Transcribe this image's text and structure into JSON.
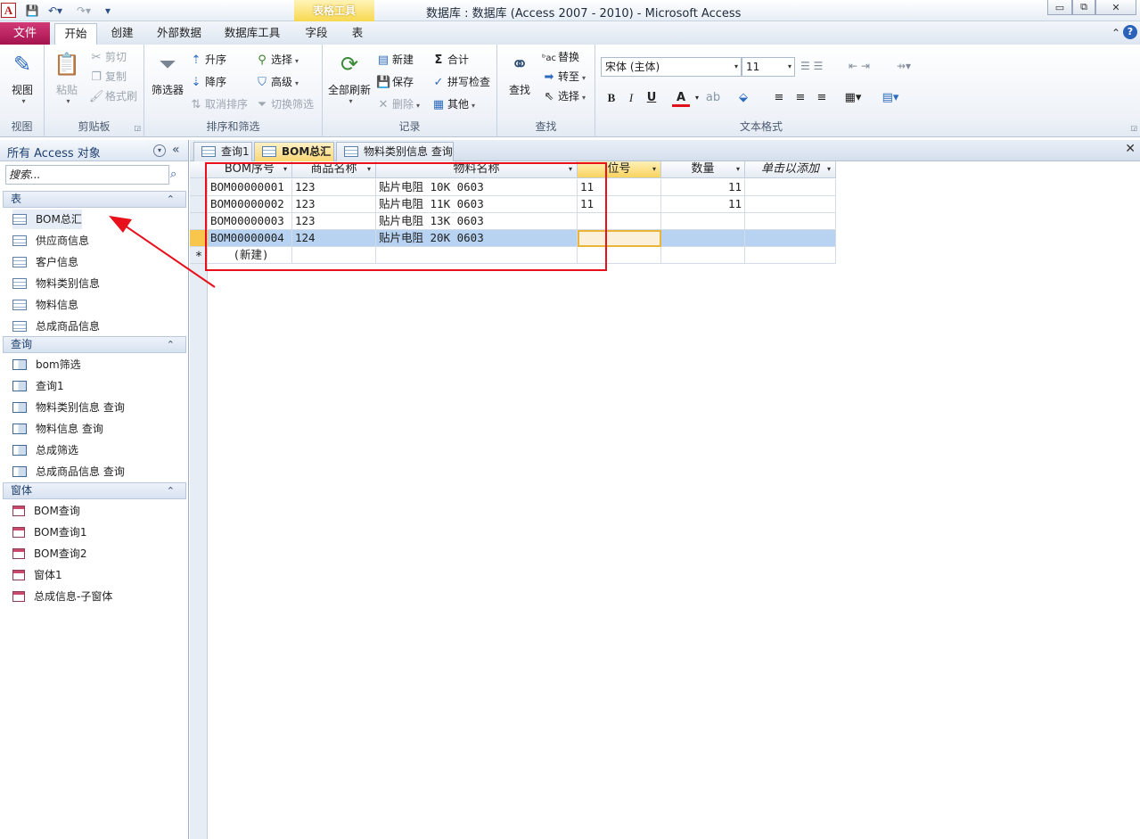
{
  "titlebar": {
    "app_icon": "A",
    "context_tab": "表格工具",
    "title": "数据库 : 数据库 (Access 2007 - 2010)  -  Microsoft Access",
    "minimize": "▭",
    "restore": "⧉",
    "close": "✕"
  },
  "ribbon_tabs": {
    "file": "文件",
    "tabs": [
      "开始",
      "创建",
      "外部数据",
      "数据库工具",
      "字段",
      "表"
    ],
    "collapse": "⌃",
    "help": "?"
  },
  "ribbon": {
    "views": {
      "label": "视图",
      "button": "视图"
    },
    "clipboard": {
      "label": "剪贴板",
      "paste": "粘贴",
      "cut": "剪切",
      "copy": "复制",
      "format_painter": "格式刷"
    },
    "sort_filter": {
      "label": "排序和筛选",
      "filter": "筛选器",
      "ascending": "升序",
      "descending": "降序",
      "remove_sort": "取消排序",
      "selection": "选择",
      "advanced": "高级",
      "toggle_filter": "切换筛选"
    },
    "records": {
      "label": "记录",
      "refresh_all": "全部刷新",
      "new": "新建",
      "save": "保存",
      "delete": "删除",
      "totals": "合计",
      "spelling": "拼写检查",
      "more": "其他"
    },
    "find": {
      "label": "查找",
      "find": "查找",
      "replace": "替换",
      "goto": "转至",
      "select": "选择"
    },
    "text_format": {
      "label": "文本格式",
      "font": "宋体 (主体)",
      "size": "11",
      "bold": "B",
      "italic": "I",
      "underline": "U",
      "font_color": "A"
    }
  },
  "nav": {
    "title": "所有 Access 对象",
    "search_placeholder": "搜索...",
    "groups": [
      {
        "name": "表",
        "items": [
          "BOM总汇",
          "供应商信息",
          "客户信息",
          "物料类别信息",
          "物料信息",
          "总成商品信息"
        ]
      },
      {
        "name": "查询",
        "items": [
          "bom筛选",
          "查询1",
          "物料类别信息 查询",
          "物料信息 查询",
          "总成筛选",
          "总成商品信息 查询"
        ]
      },
      {
        "name": "窗体",
        "items": [
          "BOM查询",
          "BOM查询1",
          "BOM查询2",
          "窗体1",
          "总成信息-子窗体"
        ]
      }
    ]
  },
  "doc_tabs": [
    "查询1",
    "BOM总汇",
    "物料类别信息 查询"
  ],
  "datasheet": {
    "columns": [
      "BOM序号",
      "商品名称",
      "物料名称",
      "位号",
      "数量",
      "单击以添加"
    ],
    "rows": [
      [
        "BOM00000001",
        "123",
        "贴片电阻 10K 0603",
        "11",
        "11"
      ],
      [
        "BOM00000002",
        "123",
        "贴片电阻 11K 0603",
        "11",
        "11"
      ],
      [
        "BOM00000003",
        "123",
        "贴片电阻 13K 0603",
        "",
        ""
      ],
      [
        "BOM00000004",
        "124",
        "贴片电阻 20K 0603",
        "",
        ""
      ]
    ],
    "new_row_marker": "*",
    "new_row_label": "(新建)"
  },
  "colors": {
    "file_tab": "#b8185c",
    "annotation": "#e8101b",
    "selected_row": "#b8d3f2",
    "active_tab": "#f9d774"
  }
}
